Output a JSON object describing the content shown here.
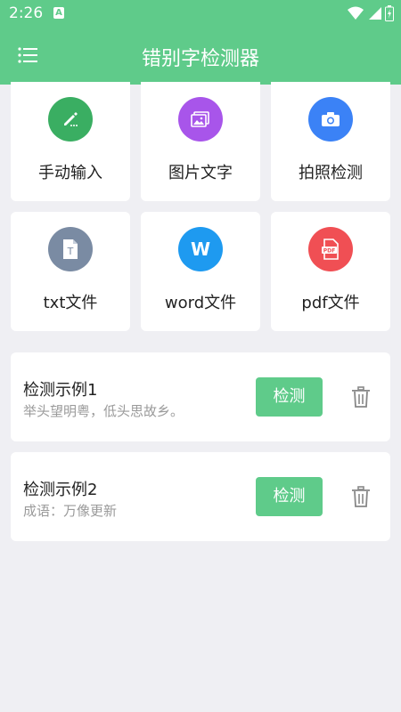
{
  "status": {
    "time": "2:26",
    "notif_letter": "A"
  },
  "app": {
    "title": "错别字检测器"
  },
  "tiles": [
    {
      "label": "手动输入",
      "color": "#3aae62",
      "icon": "pencil-icon"
    },
    {
      "label": "图片文字",
      "color": "#a855ea",
      "icon": "image-icon"
    },
    {
      "label": "拍照检测",
      "color": "#3b82f6",
      "icon": "camera-icon"
    },
    {
      "label": "txt文件",
      "color": "#7a8ba3",
      "icon": "txt-file-icon"
    },
    {
      "label": "word文件",
      "color": "#1e9af0",
      "icon": "word-icon"
    },
    {
      "label": "pdf文件",
      "color": "#f04f54",
      "icon": "pdf-icon"
    }
  ],
  "examples": [
    {
      "title": "检测示例1",
      "text": "举头望明粤，低头思故乡。",
      "button": "检测"
    },
    {
      "title": "检测示例2",
      "text": "成语：万像更新",
      "button": "检测"
    }
  ],
  "icon_text": {
    "word": "W",
    "txt": "T",
    "pdf": "PDF"
  }
}
